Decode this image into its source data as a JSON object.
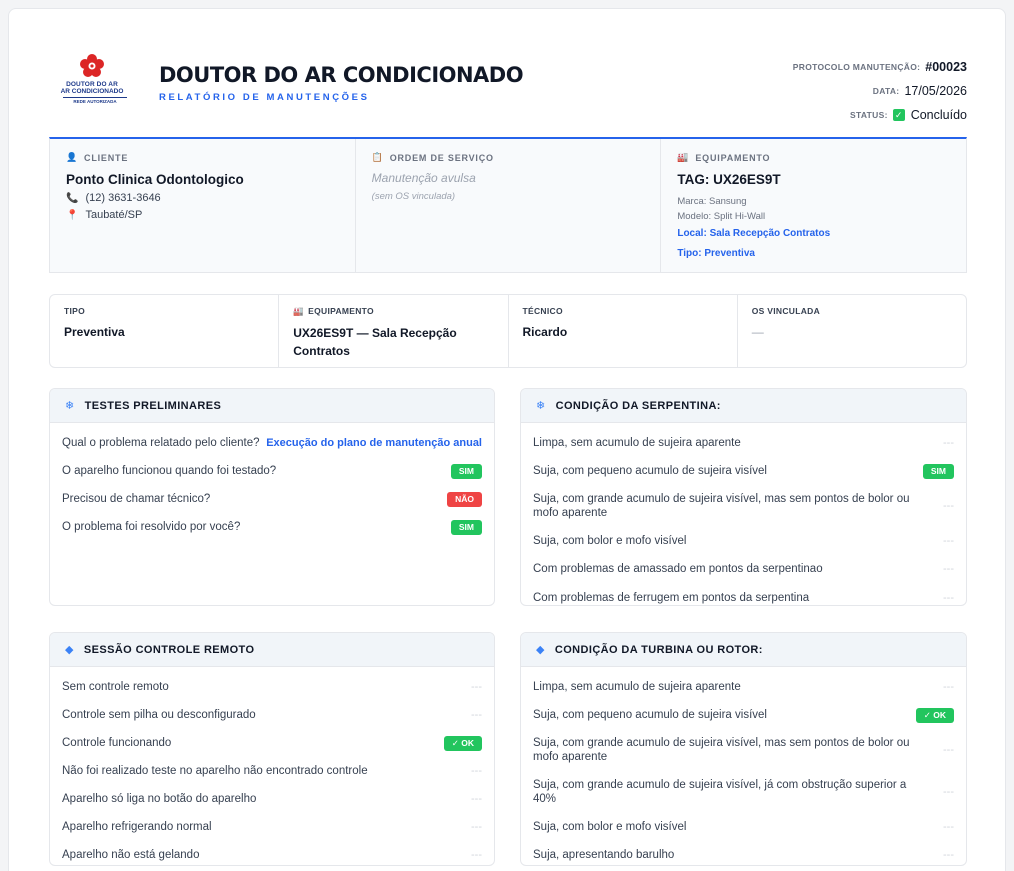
{
  "header": {
    "logo_line1": "DOUTOR DO AR",
    "logo_line2": "AR CONDICIONADO",
    "logo_line3": "REDE AUTORIZADA",
    "title": "DOUTOR DO AR CONDICIONADO",
    "subtitle": "RELATÓRIO DE MANUTENÇÕES",
    "protocol_label": "PROTOCOLO MANUTENÇÃO:",
    "protocol_value": "#00023",
    "date_label": "DATA:",
    "date_value": "17/05/2026",
    "status_label": "STATUS:",
    "status_value": "Concluído"
  },
  "info": {
    "client": {
      "label": "CLIENTE",
      "name": "Ponto Clinica Odontologico",
      "phone": "(12) 3631-3646",
      "city": "Taubaté/SP"
    },
    "order": {
      "label": "ORDEM DE SERVIÇO",
      "value": "Manutenção avulsa",
      "note": "(sem OS vinculada)"
    },
    "equipment": {
      "label": "EQUIPAMENTO",
      "tag": "TAG: UX26ES9T",
      "brand": "Marca: Sansung",
      "model": "Modelo: Split Hi-Wall",
      "location": "Local: Sala Recepção Contratos",
      "type": "Tipo: Preventiva"
    }
  },
  "summary": [
    {
      "label": "TIPO",
      "value": "Preventiva"
    },
    {
      "label": "EQUIPAMENTO",
      "value": "UX26ES9T — Sala Recepção Contratos"
    },
    {
      "label": "TÉCNICO",
      "value": "Ricardo"
    },
    {
      "label": "OS VINCULADA",
      "value": "—"
    }
  ],
  "panels": {
    "preliminary": {
      "title": "TESTES PRELIMINARES",
      "rows": [
        {
          "text": "Qual o problema relatado pelo cliente?",
          "answer": "Execução do plano de manutenção anual"
        },
        {
          "text": "O aparelho funcionou quando foi testado?",
          "answer": "SIM"
        },
        {
          "text": "Precisou de chamar técnico?",
          "answer": "NÃO"
        },
        {
          "text": "O problema foi resolvido por você?",
          "answer": "SIM"
        }
      ]
    },
    "coil": {
      "title": "CONDIÇÃO DA SERPENTINA:",
      "rows": [
        {
          "text": "Limpa, sem acumulo de sujeira aparente",
          "answer": "---"
        },
        {
          "text": "Suja, com pequeno acumulo de sujeira visível",
          "answer": "SIM"
        },
        {
          "text": "Suja, com grande acumulo de sujeira visível, mas sem pontos de bolor ou mofo aparente",
          "answer": "---"
        },
        {
          "text": "Suja, com bolor e mofo visível",
          "answer": "---"
        },
        {
          "text": "Com problemas de amassado em pontos da serpentinao",
          "answer": "---"
        },
        {
          "text": "Com problemas de ferrugem em pontos da serpentina",
          "answer": "---"
        }
      ]
    },
    "remote": {
      "title": "SESSÃO CONTROLE REMOTO",
      "rows": [
        {
          "text": "Sem controle remoto",
          "answer": "---"
        },
        {
          "text": "Controle sem pilha ou desconfigurado",
          "answer": "---"
        },
        {
          "text": "Controle funcionando",
          "answer": "✓ OK"
        },
        {
          "text": "Não foi realizado teste no aparelho não encontrado controle",
          "answer": "---"
        },
        {
          "text": "Aparelho só liga no botão do aparelho",
          "answer": "---"
        },
        {
          "text": "Aparelho refrigerando normal",
          "answer": "---"
        },
        {
          "text": "Aparelho não está gelando",
          "answer": "---"
        }
      ]
    },
    "turbine": {
      "title": "CONDIÇÃO DA TURBINA OU ROTOR:",
      "rows": [
        {
          "text": "Limpa, sem acumulo de sujeira aparente",
          "answer": "---"
        },
        {
          "text": "Suja, com pequeno acumulo de sujeira visível",
          "answer": "✓ OK"
        },
        {
          "text": "Suja, com grande acumulo de sujeira visível, mas sem pontos de bolor ou mofo aparente",
          "answer": "---"
        },
        {
          "text": "Suja, com grande acumulo de sujeira visível, já com obstrução superior a 40%",
          "answer": "---"
        },
        {
          "text": "Suja, com bolor e mofo visível",
          "answer": "---"
        },
        {
          "text": "Suja, apresentando barulho",
          "answer": "---"
        }
      ]
    }
  },
  "colors": {
    "accent": "#2563eb",
    "ok_green": "#22c55e",
    "no_red": "#ef4444",
    "logo_red": "#dc2626"
  }
}
